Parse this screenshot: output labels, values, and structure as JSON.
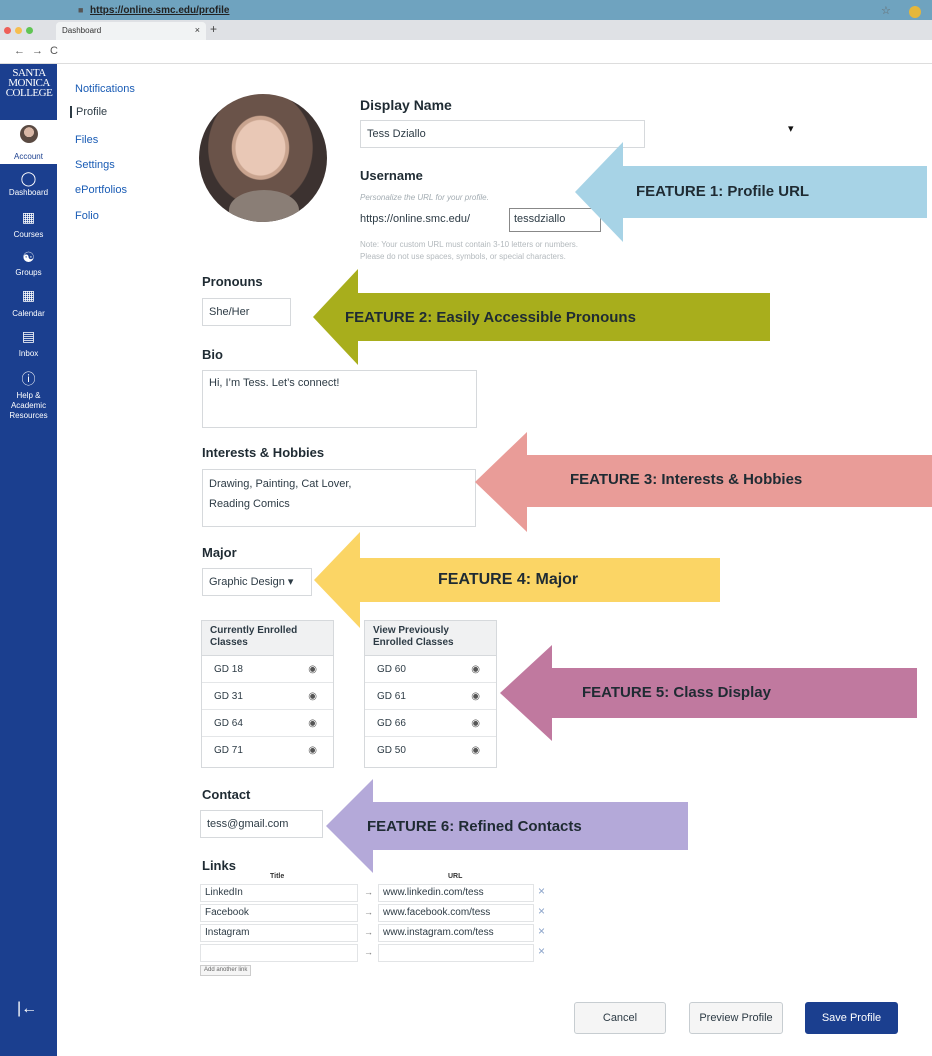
{
  "browser": {
    "tab_title": "Dashboard",
    "tab_close": "×",
    "new_tab": "+",
    "url": "https://online.smc.edu/profile",
    "back": "←",
    "forward": "→",
    "reload": "C",
    "star": "☆"
  },
  "global_nav": {
    "logo_lines": [
      "SANTA",
      "MONICA",
      "COLLEGE"
    ],
    "items": [
      {
        "label": "Account",
        "icon": "user-avatar"
      },
      {
        "label": "Dashboard",
        "icon": "dashboard-icon"
      },
      {
        "label": "Courses",
        "icon": "courses-icon"
      },
      {
        "label": "Groups",
        "icon": "groups-icon"
      },
      {
        "label": "Calendar",
        "icon": "calendar-icon"
      },
      {
        "label": "Inbox",
        "icon": "inbox-icon"
      },
      {
        "label": "Help & Academic Resources",
        "icon": "help-icon"
      }
    ],
    "collapse": "|←"
  },
  "sub_nav": [
    "Notifications",
    "Profile",
    "Files",
    "Settings",
    "ePortfolios",
    "Folio"
  ],
  "profile": {
    "display_name_label": "Display Name",
    "display_name": "Tess Dziallo",
    "username_label": "Username",
    "username_hint": "Personalize the URL for your profile.",
    "url_prefix": "https://online.smc.edu/",
    "username": "tessdziallo",
    "username_note_1": "Note: Your custom URL must contain 3-10 letters or numbers.",
    "username_note_2": "Please do not use spaces, symbols, or special characters.",
    "pronouns_label": "Pronouns",
    "pronouns": "She/Her",
    "bio_label": "Bio",
    "bio": "Hi, I’m Tess. Let’s connect!",
    "interests_label": "Interests & Hobbies",
    "interests_line1": "Drawing, Painting, Cat Lover,",
    "interests_line2": "Reading Comics",
    "major_label": "Major",
    "major": "Graphic Design",
    "current_classes_header": "Currently Enrolled Classes",
    "previous_classes_header": "View Previously Enrolled Classes",
    "current_classes": [
      "GD 18",
      "GD 31",
      "GD 64",
      "GD 71"
    ],
    "previous_classes": [
      "GD 60",
      "GD 61",
      "GD 66",
      "GD 50"
    ],
    "contact_label": "Contact",
    "contact": "tess@gmail.com",
    "links_label": "Links",
    "links_title_header": "Title",
    "links_url_header": "URL",
    "links": [
      {
        "title": "LinkedIn",
        "url": "www.linkedin.com/tess"
      },
      {
        "title": "Facebook",
        "url": "www.facebook.com/tess"
      },
      {
        "title": "Instagram",
        "url": "www.instagram.com/tess"
      },
      {
        "title": "",
        "url": ""
      }
    ],
    "add_link": "Add another link"
  },
  "features": [
    {
      "label": "FEATURE 1: Profile URL",
      "color": "#a7d3e6"
    },
    {
      "label": "FEATURE 2: Easily Accessible Pronouns",
      "color": "#a8ae1c"
    },
    {
      "label": "FEATURE 3: Interests & Hobbies",
      "color": "#e99c98"
    },
    {
      "label": "FEATURE 4: Major",
      "color": "#fbd565"
    },
    {
      "label": "FEATURE 5: Class Display",
      "color": "#c0799f"
    },
    {
      "label": "FEATURE 6: Refined Contacts",
      "color": "#b4a9d9"
    }
  ],
  "buttons": {
    "cancel": "Cancel",
    "preview": "Preview Profile",
    "save": "Save Profile"
  },
  "icons": {
    "eye": "◉",
    "remove": "×",
    "arrow": "→",
    "caret": "▾",
    "lock": "🔒"
  }
}
